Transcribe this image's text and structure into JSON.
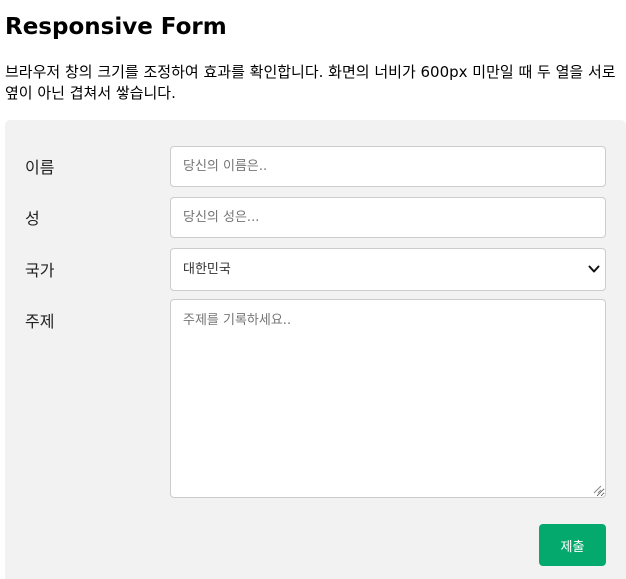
{
  "page": {
    "title": "Responsive Form",
    "description": "브라우저 창의 크기를 조정하여 효과를 확인합니다. 화면의 너비가 600px 미만일 때 두 열을 서로 옆이 아닌 겹쳐서 쌓습니다."
  },
  "form": {
    "first_name": {
      "label": "이름",
      "placeholder": "당신의 이름은..",
      "value": ""
    },
    "last_name": {
      "label": "성",
      "placeholder": "당신의 성은...",
      "value": ""
    },
    "country": {
      "label": "국가",
      "selected": "대한민국",
      "icon": "chevron-down-icon"
    },
    "subject": {
      "label": "주제",
      "placeholder": "주제를 기록하세요..",
      "value": ""
    },
    "submit_label": "제출"
  },
  "colors": {
    "submit_bg": "#04aa6d",
    "container_bg": "#f2f2f2"
  }
}
